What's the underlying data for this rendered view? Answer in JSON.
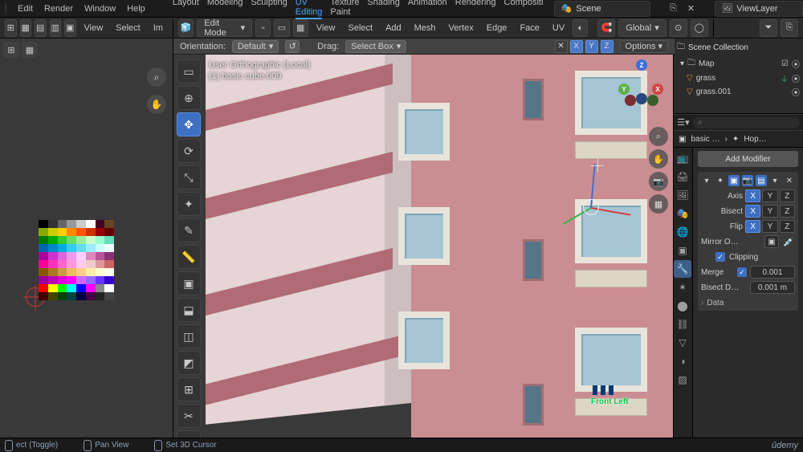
{
  "menu": [
    "Edit",
    "Render",
    "Window",
    "Help"
  ],
  "workspaces": [
    "Layout",
    "Modeling",
    "Sculpting",
    "UV Editing",
    "Texture Paint",
    "Shading",
    "Animation",
    "Rendering",
    "Compositi"
  ],
  "workspace_active": "UV Editing",
  "scene_label": "Scene",
  "viewlayer_label": "ViewLayer",
  "toolbar2": {
    "edit_mode": "Edit Mode",
    "orientation_label": "Orientation:",
    "orientation_value": "Default",
    "drag_label": "Drag:",
    "drag_value": "Select Box",
    "options_label": "Options",
    "orient_lock_icon": "✕",
    "orient_reset": "↺",
    "global": "Global",
    "view_menu": [
      "View",
      "Select",
      "Add",
      "Mesh",
      "Vertex",
      "Edge",
      "Face",
      "UV"
    ],
    "left_view_menu": [
      "View",
      "Select",
      "Im"
    ]
  },
  "viewport": {
    "info_line1": "User Orthographic (Local)",
    "info_line2": "(1)  basic cube.009",
    "front_label": "Front Left"
  },
  "outliner": {
    "title": "Scene Collection",
    "map": "Map",
    "items": [
      {
        "name": "grass"
      },
      {
        "name": "grass.001"
      }
    ],
    "search_placeholder": "⌕"
  },
  "breadcrumb": {
    "obj": "basic …",
    "mod": "Hop…"
  },
  "modifiers": {
    "add_label": "Add Modifier",
    "axis_label": "Axis",
    "bisect_label": "Bisect",
    "flip_label": "Flip",
    "axis": {
      "x": true,
      "y": false,
      "z": false
    },
    "bisect": {
      "x": true,
      "y": false,
      "z": false
    },
    "flip": {
      "x": true,
      "y": false,
      "z": false
    },
    "mirror_label": "Mirror O…",
    "clipping_label": "Clipping",
    "merge_label": "Merge",
    "merge_val": "0.001",
    "bisect_dist_label": "Bisect D…",
    "bisect_dist_val": "0.001 m",
    "data_label": "Data"
  },
  "status": {
    "a": "ect (Toggle)",
    "b": "Pan View",
    "c": "Set 3D Cursor",
    "brand": "ûdemy"
  }
}
